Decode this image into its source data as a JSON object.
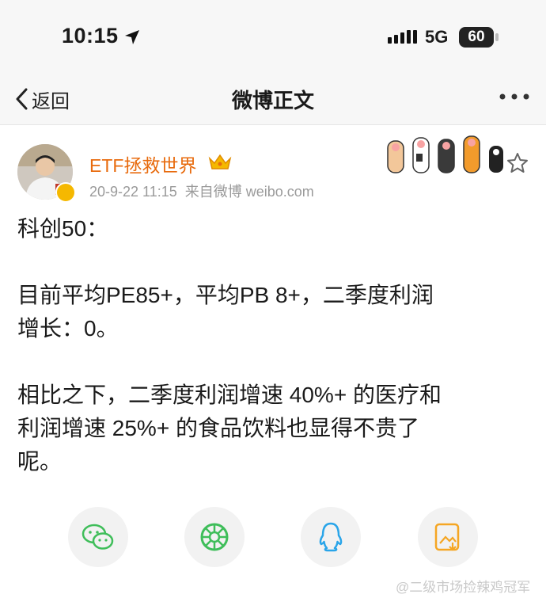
{
  "status_bar": {
    "time": "10:15",
    "network": "5G",
    "battery": "60"
  },
  "nav": {
    "back_label": "返回",
    "title": "微博正文"
  },
  "post": {
    "author": "ETF拯救世界",
    "timestamp": "20-9-22 11:15",
    "source": "来自微博 weibo.com",
    "paragraphs": [
      "科创50：",
      "目前平均PE85+，平均PB 8+，二季度利润\n增长：0。",
      "相比之下，二季度利润增速 40%+ 的医疗和\n利润增速 25%+ 的食品饮料也显得不贵了\n呢。"
    ]
  },
  "share": [
    "wechat-icon",
    "moments-icon",
    "qq-icon",
    "save-image-icon"
  ],
  "watermark": "@二级市场捡辣鸡冠军",
  "colors": {
    "accent": "#e86b0e",
    "wechat": "#3fbe5a",
    "qq": "#2aa5e9",
    "save": "#f5a623"
  }
}
